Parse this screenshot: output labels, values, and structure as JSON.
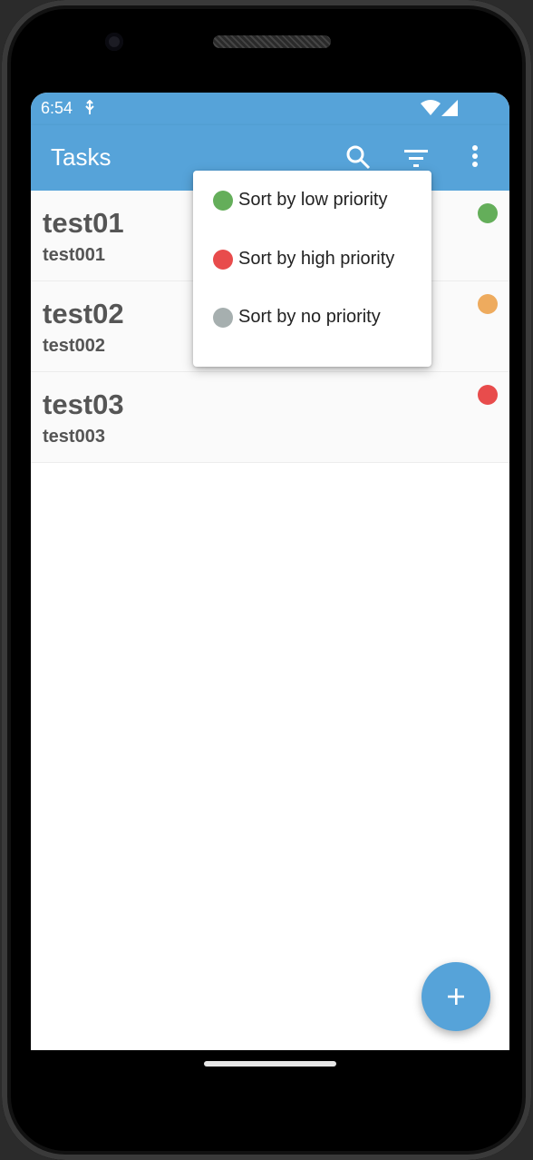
{
  "status_bar": {
    "time": "6:54",
    "icons": [
      "usb-icon",
      "wifi-icon",
      "signal-icon"
    ]
  },
  "app_bar": {
    "title": "Tasks",
    "actions": [
      "search-icon",
      "filter-icon",
      "more-vert-icon"
    ]
  },
  "tasks": [
    {
      "title": "test01",
      "description": "test001",
      "priority_color": "#64ae5a"
    },
    {
      "title": "test02",
      "description": "test002",
      "priority_color": "#eeab5e"
    },
    {
      "title": "test03",
      "description": "test003",
      "priority_color": "#e84c4c"
    }
  ],
  "sort_menu": {
    "items": [
      {
        "label": "Sort by low priority",
        "color": "#64ae5a"
      },
      {
        "label": "Sort by high priority",
        "color": "#e84c4c"
      },
      {
        "label": "Sort by no priority",
        "color": "#a6afaf"
      }
    ]
  },
  "fab": {
    "icon": "add-icon"
  },
  "colors": {
    "primary": "#56a3d9",
    "list_background": "#fafafa",
    "text": "#555555"
  }
}
